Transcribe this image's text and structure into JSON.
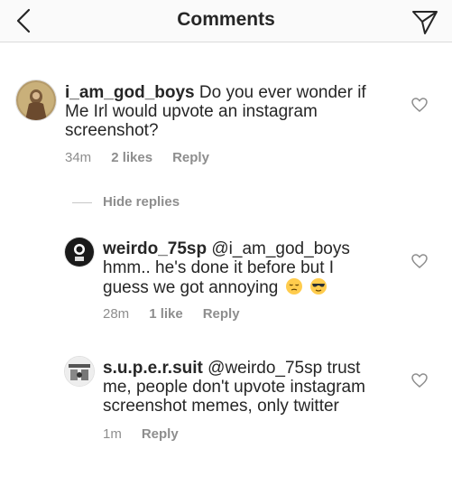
{
  "header": {
    "title": "Comments"
  },
  "comments": [
    {
      "username": "i_am_god_boys",
      "text": " Do you ever wonder if Me Irl would upvote an instagram screenshot?",
      "time": "34m",
      "likes": "2 likes",
      "reply": "Reply"
    },
    {
      "username": "weirdo_75sp",
      "mention": " @i_am_god_boys",
      "text": " hmm.. he's done it before but I guess we got annoying",
      "emojis": [
        "pensive-face-emoji",
        "sunglasses-face-emoji"
      ],
      "time": "28m",
      "likes": "1 like",
      "reply": "Reply"
    },
    {
      "username": "s.u.p.e.r.suit",
      "mention": " @weirdo_75sp",
      "text": " trust me, people don't upvote instagram screenshot memes, only twitter",
      "time": "1m",
      "reply": "Reply"
    }
  ],
  "replies": {
    "hide_label": "Hide replies"
  },
  "colors": {
    "text": "#262626",
    "secondary": "#8e8e8e",
    "divider": "#dbdbdb"
  }
}
